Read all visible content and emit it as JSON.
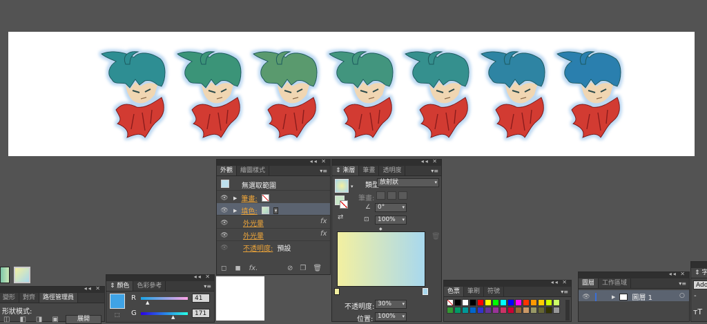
{
  "canvas": {
    "heads": [
      0,
      1,
      2,
      3,
      4,
      5,
      6
    ],
    "hair_colors": [
      "#2f8e93",
      "#3a9478",
      "#5a9a6e",
      "#43957e",
      "#35908e",
      "#2d84a3",
      "#2a7fae"
    ],
    "scarf_color": "#d23a32",
    "glow_color": "#bfdaf2"
  },
  "appearance_panel": {
    "tabs": [
      "外觀",
      "繪圖樣式"
    ],
    "title": "無選取範圍",
    "items": [
      {
        "label": "筆畫:",
        "type": "stroke"
      },
      {
        "label": "填色:",
        "type": "fill"
      },
      {
        "label": "外光暈",
        "type": "effect"
      },
      {
        "label": "外光暈",
        "type": "effect"
      }
    ],
    "opacity_label": "不透明度:",
    "opacity_value": "預設",
    "fx_label": "fx"
  },
  "gradient_panel": {
    "tabs": [
      "漸層",
      "筆畫",
      "透明度"
    ],
    "type_label": "類型:",
    "type_value": "放射狀",
    "stroke_label": "筆畫:",
    "angle_value": "0°",
    "aspect_value": "100%",
    "opacity_label": "不透明度:",
    "opacity_value": "30%",
    "location_label": "位置:",
    "location_value": "100%",
    "gradient_from": "#f3f0a0",
    "gradient_to": "#a8d8ee"
  },
  "color_panel": {
    "tabs": [
      "顏色",
      "色彩參考"
    ],
    "r_label": "R",
    "r_value": "41",
    "g_label": "G",
    "g_value": "171",
    "swatch": "#3fa3e6"
  },
  "swatches_panel": {
    "tabs": [
      "色票",
      "筆刷",
      "符號"
    ],
    "colors": [
      "#ffffff",
      "#000000",
      "#ffffff",
      "#000000",
      "#ff0000",
      "#ffff00",
      "#00ff00",
      "#00ffff",
      "#0000ff",
      "#ff00ff",
      "#ff3300",
      "#ff9900",
      "#ffcc00",
      "#ccff00",
      "#ccff66",
      "#339933",
      "#009966",
      "#009999",
      "#0066cc",
      "#3333cc",
      "#663399",
      "#993399",
      "#cc3366",
      "#cc0033",
      "#996633",
      "#cc9966",
      "#999966",
      "#666633",
      "#333300",
      "#999999"
    ]
  },
  "pathfinder_panel": {
    "tabs": [
      "變形",
      "對齊",
      "路徑管理員"
    ],
    "label": "形狀模式:",
    "expand_label": "展開"
  },
  "layers_panel": {
    "tabs": [
      "圖層",
      "工作區域"
    ],
    "layer_name": "圖層 1"
  },
  "char_panel": {
    "tab": "字元",
    "font": "Adob"
  }
}
